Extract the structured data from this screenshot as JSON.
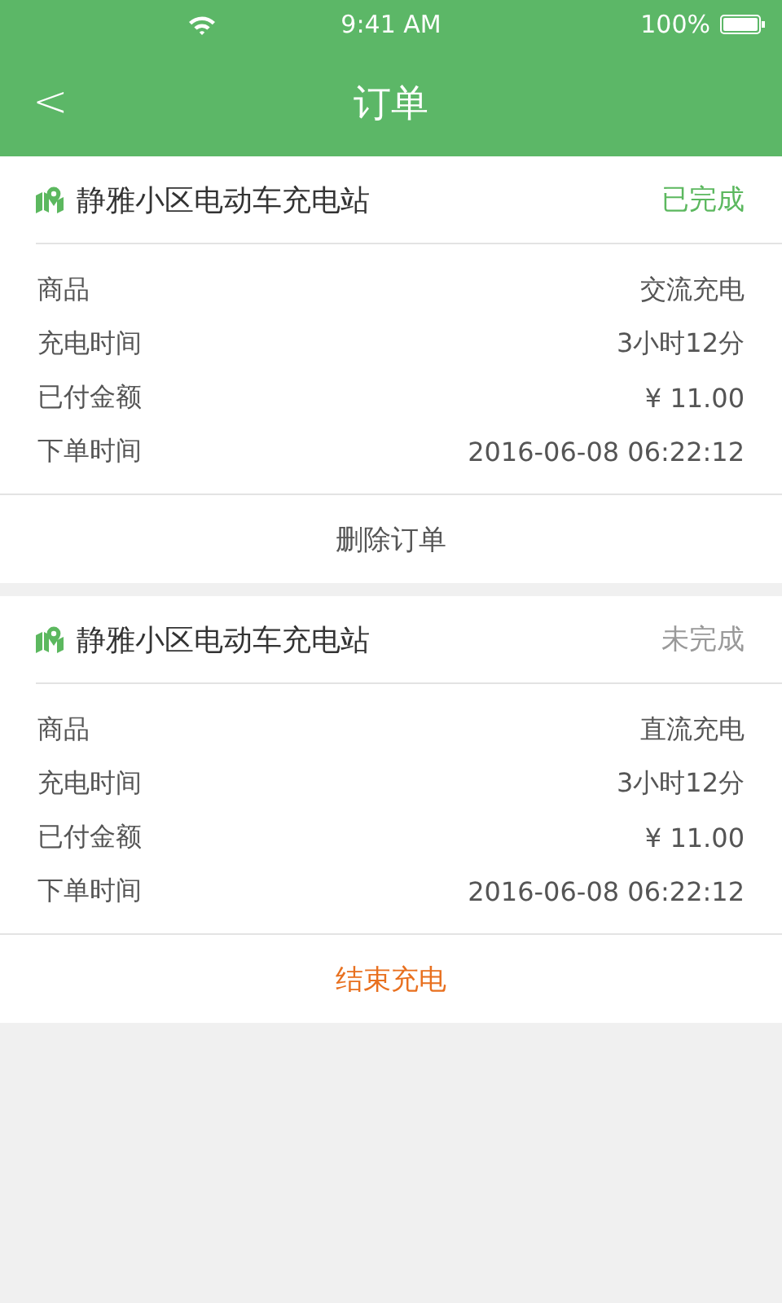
{
  "status_bar": {
    "time": "9:41 AM",
    "battery": "100%"
  },
  "nav": {
    "back": "<",
    "title": "订单"
  },
  "orders": [
    {
      "station": "静雅小区电动车充电站",
      "status": "已完成",
      "completed": true,
      "rows": [
        {
          "label": "商品",
          "value": "交流充电"
        },
        {
          "label": "充电时间",
          "value": "3小时12分"
        },
        {
          "label": "已付金额",
          "value": "¥ 11.00"
        },
        {
          "label": "下单时间",
          "value": "2016-06-08 06:22:12"
        }
      ],
      "action": {
        "label": "删除订单",
        "kind": "delete"
      }
    },
    {
      "station": "静雅小区电动车充电站",
      "status": "未完成",
      "completed": false,
      "rows": [
        {
          "label": "商品",
          "value": "直流充电"
        },
        {
          "label": "充电时间",
          "value": "3小时12分"
        },
        {
          "label": "已付金额",
          "value": "¥ 11.00"
        },
        {
          "label": "下单时间",
          "value": "2016-06-08 06:22:12"
        }
      ],
      "action": {
        "label": "结束充电",
        "kind": "end"
      }
    }
  ]
}
